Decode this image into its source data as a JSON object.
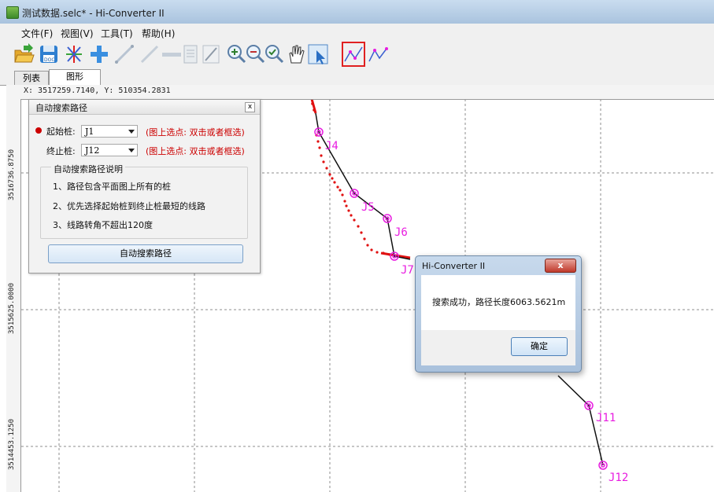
{
  "window": {
    "title": "测试数据.selc* - Hi-Converter II"
  },
  "menu": [
    {
      "label": "文件(F)"
    },
    {
      "label": "视图(V)"
    },
    {
      "label": "工具(T)"
    },
    {
      "label": "帮助(H)"
    }
  ],
  "toolbar": {
    "icons": [
      "open-icon",
      "save-icon",
      "snap-icon",
      "add-point-icon",
      "add-line-icon",
      "horizontal-line-icon",
      "document-icon",
      "edit-line-icon",
      "zoom-in-icon",
      "zoom-out-icon",
      "zoom-fit-icon",
      "pan-hand-icon",
      "select-pointer-icon",
      "auto-route-icon",
      "route-icon"
    ],
    "active_icon": "auto-route-icon",
    "active_color": "#e02020"
  },
  "tabs": [
    {
      "label": "列表"
    },
    {
      "label": "图形",
      "active": true
    }
  ],
  "canvas": {
    "coordinate_readout": "X: 3517259.7140, Y: 510354.2831",
    "y_axis_labels": [
      "3516736.8750",
      "3515625.0000",
      "3514453.1250"
    ],
    "points": [
      "J4",
      "J5",
      "J6",
      "J7",
      "J11",
      "J12"
    ]
  },
  "panel": {
    "title": "自动搜索路径",
    "close_label": "x",
    "start_label": "起始桩:",
    "start_value": "J1",
    "start_hint": "(图上选点: 双击或者框选)",
    "end_label": "终止桩:",
    "end_value": "J12",
    "end_hint": "(图上选点: 双击或者框选)",
    "group_title": "自动搜索路径说明",
    "notes": [
      "1、路径包含平面图上所有的桩",
      "2、优先选择起始桩到终止桩最短的线路",
      "3、线路转角不超出120度"
    ],
    "button_label": "自动搜索路径"
  },
  "dialog": {
    "title": "Hi-Converter II",
    "close_label": "x",
    "message": "搜索成功，路径长度6063.5621m",
    "ok_label": "确定"
  },
  "colors": {
    "point_color": "#e81ce0",
    "route_red": "#e01010",
    "route_black": "#111111",
    "accent": "#e02020"
  }
}
